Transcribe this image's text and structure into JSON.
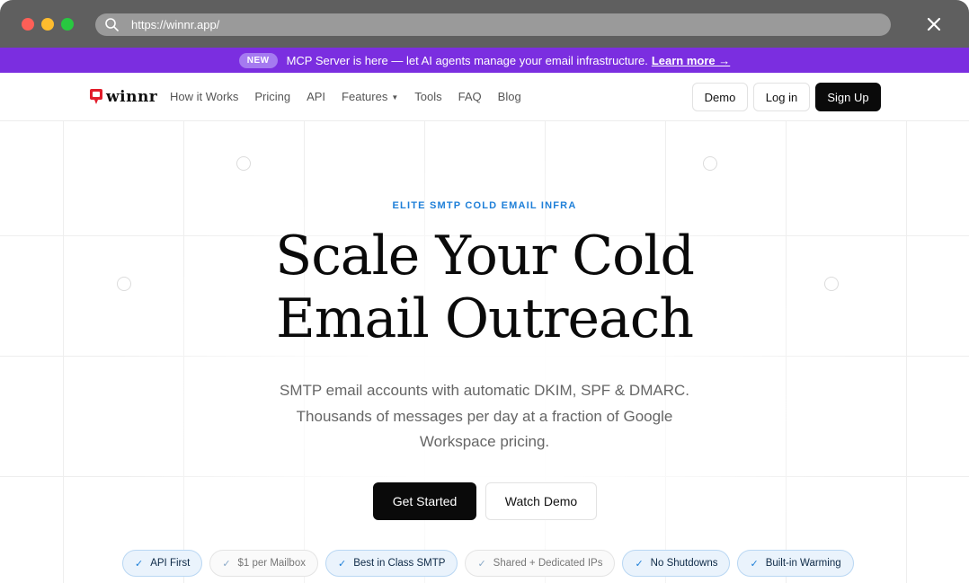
{
  "browser": {
    "url": "https://winnr.app/",
    "icons": {
      "search": "search-icon",
      "close": "close-icon"
    },
    "traffic_lights": [
      "#fe5f57",
      "#febc2e",
      "#28c840"
    ]
  },
  "announcement": {
    "badge": "NEW",
    "text": "MCP Server is here — let AI agents manage your email infrastructure.",
    "link": "Learn more →",
    "background": "#7b2ee0"
  },
  "nav": {
    "logo": "winnr",
    "links": [
      {
        "label": "How it Works"
      },
      {
        "label": "Pricing"
      },
      {
        "label": "API"
      },
      {
        "label": "Features",
        "has_dropdown": true
      },
      {
        "label": "Tools"
      },
      {
        "label": "FAQ"
      },
      {
        "label": "Blog"
      }
    ],
    "demo_label": "Demo",
    "login_label": "Log in",
    "signup_label": "Sign Up"
  },
  "hero": {
    "eyebrow": "ELITE SMTP COLD EMAIL INFRA",
    "headline_line1": "Scale Your Cold",
    "headline_line2": "Email Outreach",
    "subtext": "SMTP email accounts with automatic DKIM, SPF & DMARC. Thousands of messages per day at a fraction of Google Workspace pricing.",
    "primary_cta": "Get Started",
    "secondary_cta": "Watch Demo",
    "accent_color": "#1e7fd8"
  },
  "features": [
    {
      "label": "API First",
      "style": "blue"
    },
    {
      "label": "$1 per Mailbox",
      "style": "grey"
    },
    {
      "label": "Best in Class SMTP",
      "style": "blue"
    },
    {
      "label": "Shared + Dedicated IPs",
      "style": "grey"
    },
    {
      "label": "No Shutdowns",
      "style": "blue"
    },
    {
      "label": "Built-in Warming",
      "style": "blue"
    }
  ]
}
